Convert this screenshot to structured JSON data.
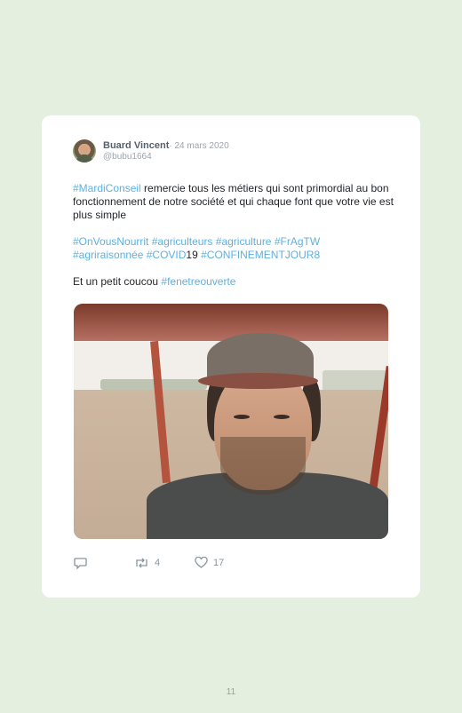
{
  "tweet": {
    "author_name": "Buard Vincent",
    "date": "· 24 mars 2020",
    "handle": "@bubu1664",
    "paragraph1": {
      "tag": "#MardiConseil",
      "text": " remercie tous les métiers qui sont primordial au bon fonctionnement de notre société et qui chaque font que votre vie est plus simple"
    },
    "paragraph2": {
      "tag1": "#OnVousNourrit",
      "tag2": "#agriculteurs",
      "tag3": "#agriculture",
      "tag4": "#FrAgTW",
      "tag5": "#agriraisonnée",
      "tag6": "#COVID",
      "text6": "19 ",
      "tag7": "#CONFINEMENTJOUR8"
    },
    "paragraph3": {
      "text": "Et un petit coucou ",
      "tag": "#fenetreouverte"
    },
    "actions": {
      "reply_icon": "reply-icon",
      "retweet_icon": "retweet-icon",
      "retweet_count": "4",
      "like_icon": "heart-icon",
      "like_count": "17"
    }
  },
  "page_number": "11",
  "colors": {
    "background": "#e4efdf",
    "card": "#ffffff",
    "hashtag": "#5fb0e0",
    "muted": "#9aa4ad"
  }
}
